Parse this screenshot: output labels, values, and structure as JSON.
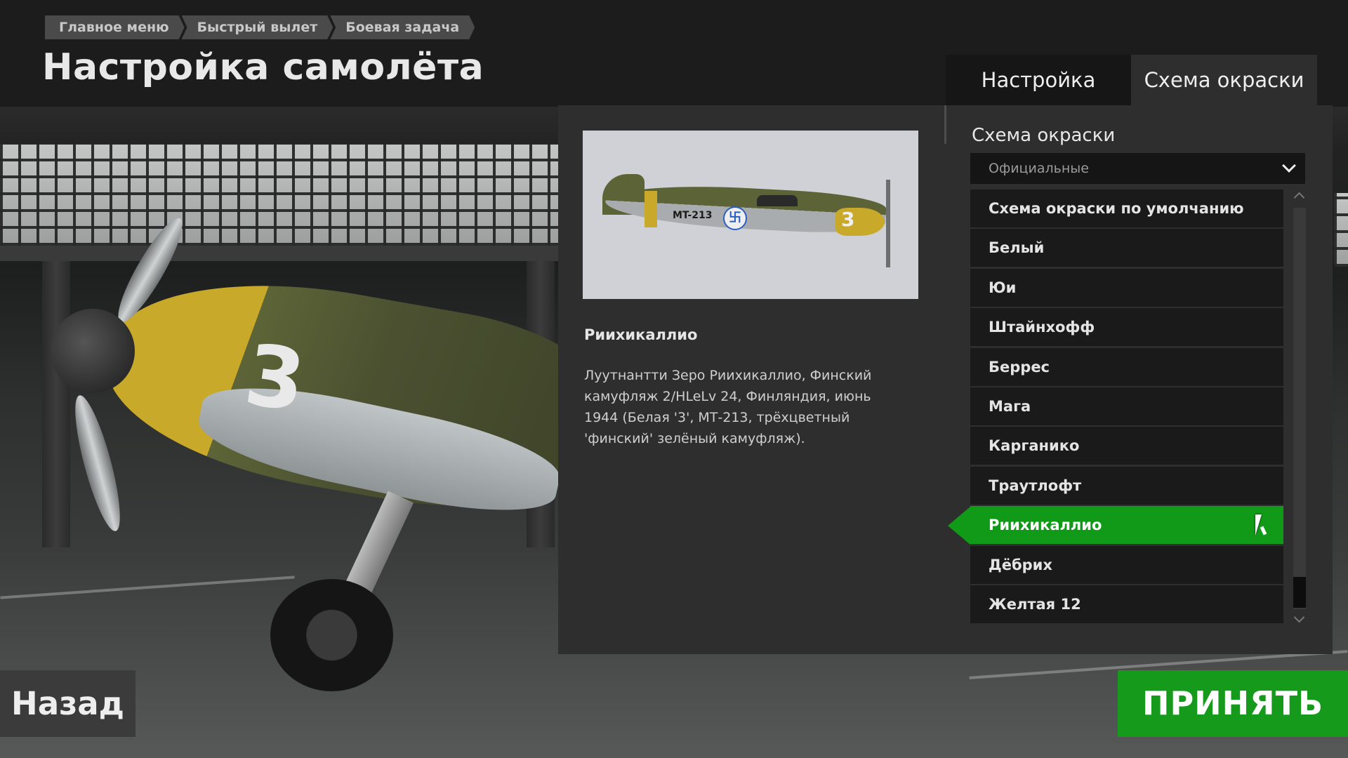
{
  "breadcrumb": [
    "Главное меню",
    "Быстрый вылет",
    "Боевая задача"
  ],
  "page_title": "Настройка самолёта",
  "tabs": {
    "setup": "Настройка",
    "paint": "Схема окраски"
  },
  "preview": {
    "code": "MT-213",
    "number": "3",
    "roundel": "卐"
  },
  "selected_skin": {
    "name": "Риихикаллио",
    "description": "Луутнантти Зеро Риихикаллио, Финский камуфляж 2/HLeLv 24, Финляндия, июнь 1944 (Белая '3', МТ-213, трёхцветный 'финский' зелёный камуфляж)."
  },
  "paint_list": {
    "title": "Схема окраски",
    "filter_value": "Официальные",
    "items": [
      "Схема окраски по умолчанию",
      "Белый",
      "Юи",
      "Штайнхофф",
      "Беррес",
      "Мага",
      "Карганико",
      "Траутлофт",
      "Риихикаллио",
      "Дёбрих",
      "Желтая 12"
    ],
    "selected_index": 8
  },
  "buttons": {
    "back": "Назад",
    "accept": "ПРИНЯТЬ"
  },
  "colors": {
    "accent": "#119a17",
    "panel": "#2e2e2e",
    "item": "#1a1a1a"
  }
}
